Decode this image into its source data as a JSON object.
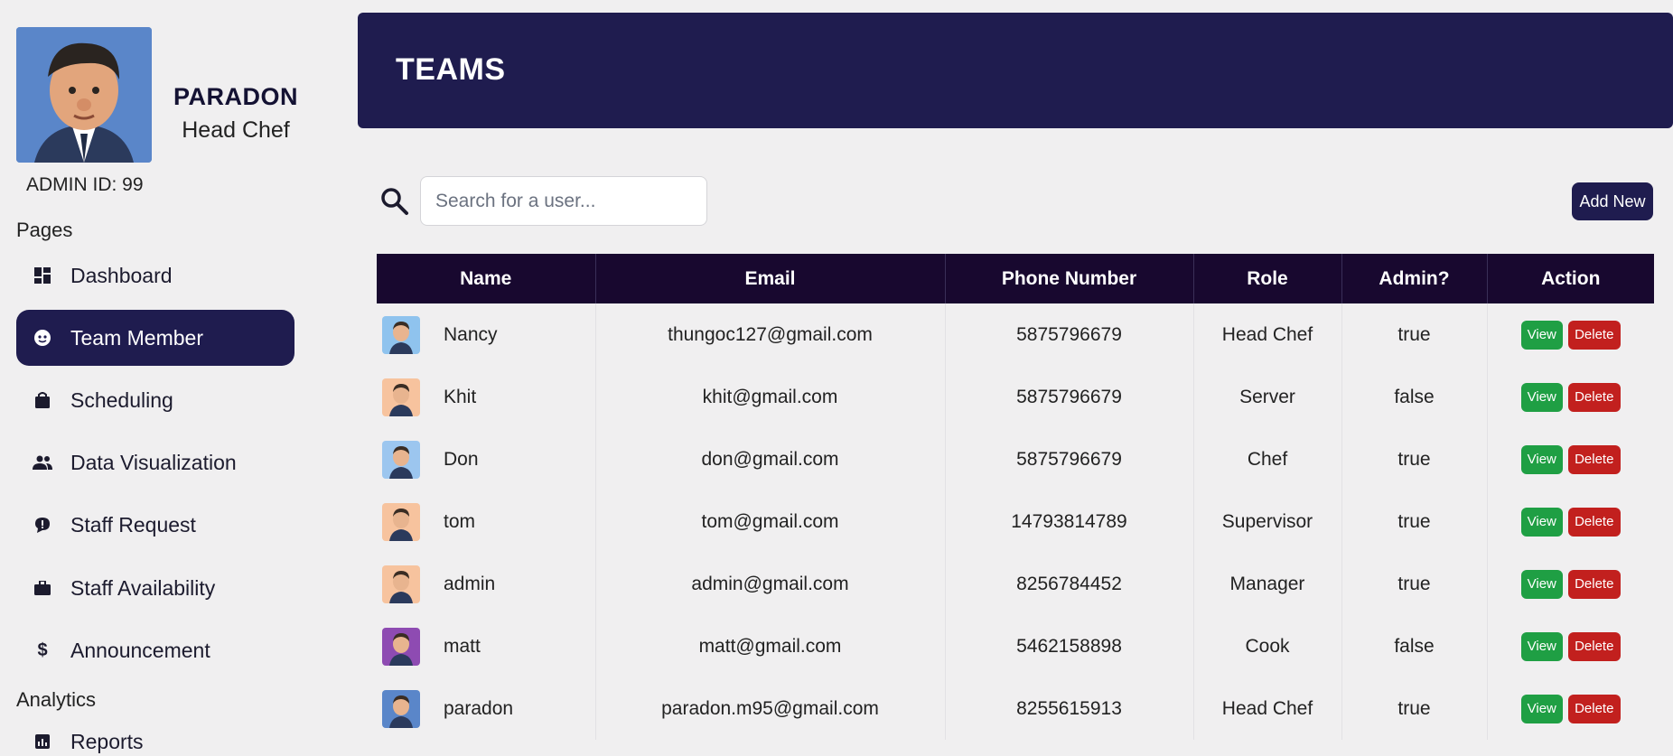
{
  "profile": {
    "name": "PARADON",
    "role": "Head Chef",
    "admin_id": "ADMIN ID: 99"
  },
  "sidebar": {
    "pages_title": "Pages",
    "analytics_title": "Analytics",
    "items": [
      {
        "label": "Dashboard",
        "icon": "dashboard-icon"
      },
      {
        "label": "Team Member",
        "icon": "face-icon",
        "active": true
      },
      {
        "label": "Scheduling",
        "icon": "bag-icon"
      },
      {
        "label": "Data Visualization",
        "icon": "people-icon"
      },
      {
        "label": "Staff Request",
        "icon": "chat-icon"
      },
      {
        "label": "Staff Availability",
        "icon": "briefcase-icon"
      },
      {
        "label": "Announcement",
        "icon": "dollar-icon"
      }
    ],
    "analytics_items": [
      {
        "label": "Reports",
        "icon": "chart-icon"
      }
    ]
  },
  "header": {
    "title": "TEAMS"
  },
  "search": {
    "placeholder": "Search for a user..."
  },
  "toolbar": {
    "add_label": "Add New"
  },
  "table": {
    "columns": [
      "Name",
      "Email",
      "Phone Number",
      "Role",
      "Admin?",
      "Action"
    ],
    "view_label": "View",
    "delete_label": "Delete",
    "rows": [
      {
        "name": "Nancy",
        "email": "thungoc127@gmail.com",
        "phone": "5875796679",
        "role": "Head Chef",
        "admin": "true",
        "avatar_color": "#8fc3ee"
      },
      {
        "name": "Khit",
        "email": "khit@gmail.com",
        "phone": "5875796679",
        "role": "Server",
        "admin": "false",
        "avatar_color": "#f7c39e"
      },
      {
        "name": "Don",
        "email": "don@gmail.com",
        "phone": "5875796679",
        "role": "Chef",
        "admin": "true",
        "avatar_color": "#9cc6ef"
      },
      {
        "name": "tom",
        "email": "tom@gmail.com",
        "phone": "14793814789",
        "role": "Supervisor",
        "admin": "true",
        "avatar_color": "#f7c39e"
      },
      {
        "name": "admin",
        "email": "admin@gmail.com",
        "phone": "8256784452",
        "role": "Manager",
        "admin": "true",
        "avatar_color": "#f7c39e"
      },
      {
        "name": "matt",
        "email": "matt@gmail.com",
        "phone": "5462158898",
        "role": "Cook",
        "admin": "false",
        "avatar_color": "#8e4bb2"
      },
      {
        "name": "paradon",
        "email": "paradon.m95@gmail.com",
        "phone": "8255615913",
        "role": "Head Chef",
        "admin": "true",
        "avatar_color": "#5a86c9"
      }
    ]
  },
  "colors": {
    "primary": "#1f1c4f",
    "table_header": "#18082f",
    "view": "#1f9f44",
    "delete": "#c2201e"
  }
}
